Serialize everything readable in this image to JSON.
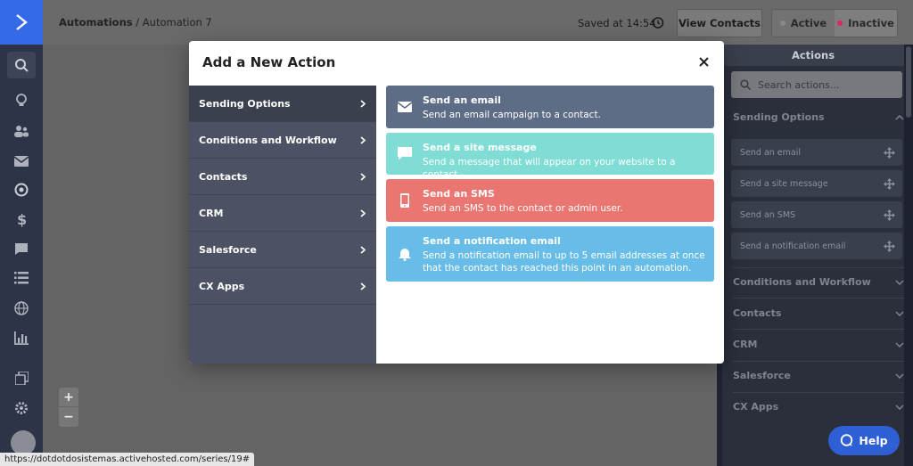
{
  "breadcrumb": {
    "root": "Automations",
    "separator": "/",
    "current": "Automation 7"
  },
  "header": {
    "saved_text": "Saved at 14:54",
    "view_contacts": "View Contacts",
    "status_active": "Active",
    "status_inactive": "Inactive"
  },
  "colors": {
    "brand": "#356ae6",
    "active_dot": "#4caf50",
    "inactive_dot": "#e0245e"
  },
  "nav_icons": [
    "search-icon",
    "lightbulb-icon",
    "contacts-icon",
    "email-icon",
    "automations-icon",
    "deals-icon",
    "conversations-icon",
    "lists-icon",
    "website-icon",
    "reports-icon",
    "pages-icon",
    "settings-icon"
  ],
  "modal": {
    "title": "Add a New Action",
    "categories": [
      {
        "label": "Sending Options",
        "selected": true
      },
      {
        "label": "Conditions and Workflow"
      },
      {
        "label": "Contacts"
      },
      {
        "label": "CRM"
      },
      {
        "label": "Salesforce"
      },
      {
        "label": "CX Apps"
      }
    ],
    "actions": [
      {
        "title": "Send an email",
        "desc": "Send an email campaign to a contact.",
        "icon": "envelope-icon",
        "color": "#5d6d86"
      },
      {
        "title": "Send a site message",
        "desc": "Send a message that will appear on your website to a contact.",
        "icon": "chat-bubble-icon",
        "color": "#7fddd5"
      },
      {
        "title": "Send an SMS",
        "desc": "Send an SMS to the contact or admin user.",
        "icon": "phone-icon",
        "color": "#ea7671"
      },
      {
        "title": "Send a notification email",
        "desc": "Send a notification email to up to 5 email addresses at once that the contact has reached this point in an automation.",
        "icon": "bell-icon",
        "color": "#67bde8"
      }
    ]
  },
  "right_panel": {
    "title": "Actions",
    "search_placeholder": "Search actions...",
    "sections": [
      {
        "label": "Sending Options",
        "expanded": true
      },
      {
        "label": "Conditions and Workflow"
      },
      {
        "label": "Contacts"
      },
      {
        "label": "CRM"
      },
      {
        "label": "Salesforce"
      },
      {
        "label": "CX Apps"
      }
    ],
    "sending_actions": [
      "Send an email",
      "Send a site message",
      "Send an SMS",
      "Send a notification email"
    ]
  },
  "zoom": {
    "in": "+",
    "out": "−"
  },
  "help_label": "Help",
  "status_url": "https://dotdotdosistemas.activehosted.com/series/19#"
}
